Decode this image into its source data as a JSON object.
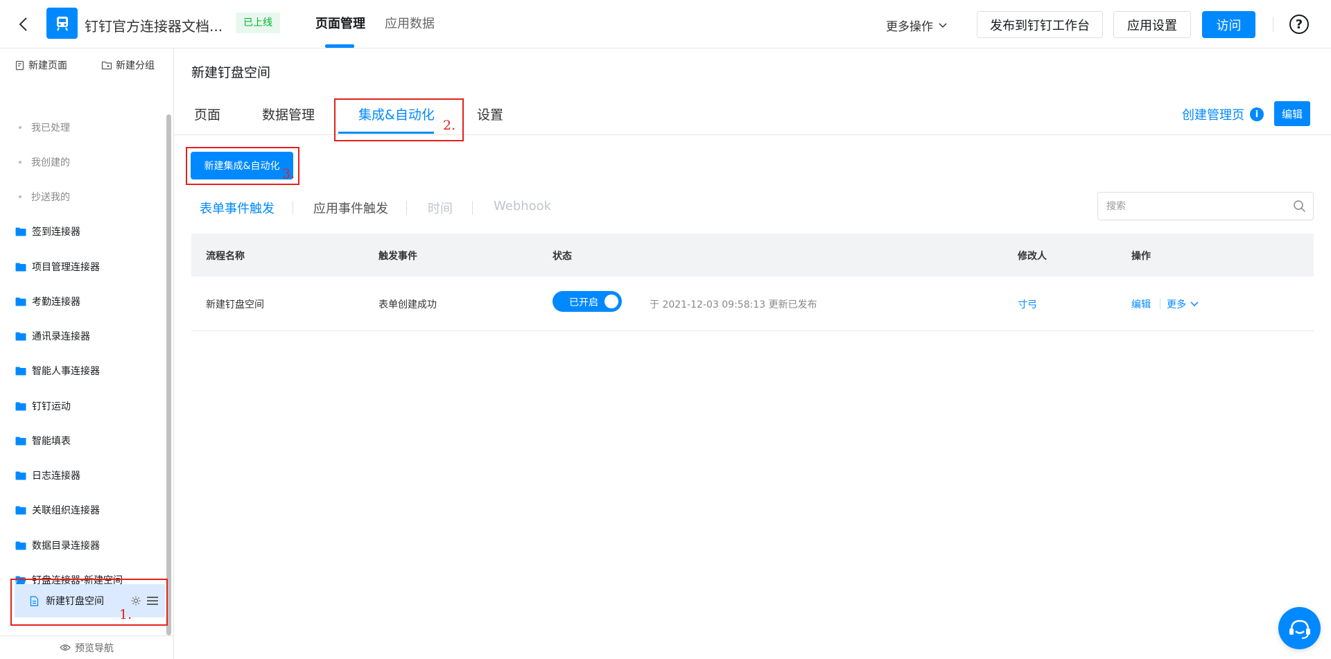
{
  "header": {
    "app_title": "钉钉官方连接器文档...",
    "status_badge": "已上线",
    "tabs": [
      {
        "label": "页面管理",
        "active": true
      },
      {
        "label": "应用数据",
        "active": false
      }
    ],
    "more_ops": "更多操作",
    "publish_button": "发布到钉钉工作台",
    "settings_button": "应用设置",
    "visit_button": "访问",
    "help": "?"
  },
  "sidebar": {
    "new_page": "新建页面",
    "new_group": "新建分组",
    "sub_items": [
      "我已处理",
      "我创建的",
      "抄送我的"
    ],
    "folders": [
      "签到连接器",
      "项目管理连接器",
      "考勤连接器",
      "通讯录连接器",
      "智能人事连接器",
      "钉钉运动",
      "智能填表",
      "日志连接器",
      "关联组织连接器",
      "数据目录连接器",
      "钉盘连接器-新建空间"
    ],
    "selected_page": "新建钉盘空间",
    "footer": "预览导航",
    "annotation": "1."
  },
  "main": {
    "page_title": "新建钉盘空间",
    "tabs": [
      {
        "label": "页面",
        "active": false
      },
      {
        "label": "数据管理",
        "active": false
      },
      {
        "label": "集成&自动化",
        "active": true
      },
      {
        "label": "设置",
        "active": false
      }
    ],
    "tab_annotation": "2.",
    "create_admin_page": "创建管理页",
    "edit_button": "编辑",
    "new_button": "新建集成&自动化",
    "button_annotation": "3.",
    "filters": [
      {
        "label": "表单事件触发",
        "state": "active"
      },
      {
        "label": "应用事件触发",
        "state": "normal"
      },
      {
        "label": "时间",
        "state": "disabled"
      },
      {
        "label": "Webhook",
        "state": "disabled"
      }
    ],
    "search_placeholder": "搜索",
    "table": {
      "columns": [
        "流程名称",
        "触发事件",
        "状态",
        "修改人",
        "操作"
      ],
      "rows": [
        {
          "name": "新建钉盘空间",
          "trigger": "表单创建成功",
          "status": "已开启",
          "updated": "于 2021-12-03 09:58:13 更新已发布",
          "modifier": "寸弓",
          "edit": "编辑",
          "more": "更多"
        }
      ]
    }
  },
  "colors": {
    "primary": "#0089ff",
    "annotation_red": "#e5201b",
    "online_green": "#00b42a"
  }
}
